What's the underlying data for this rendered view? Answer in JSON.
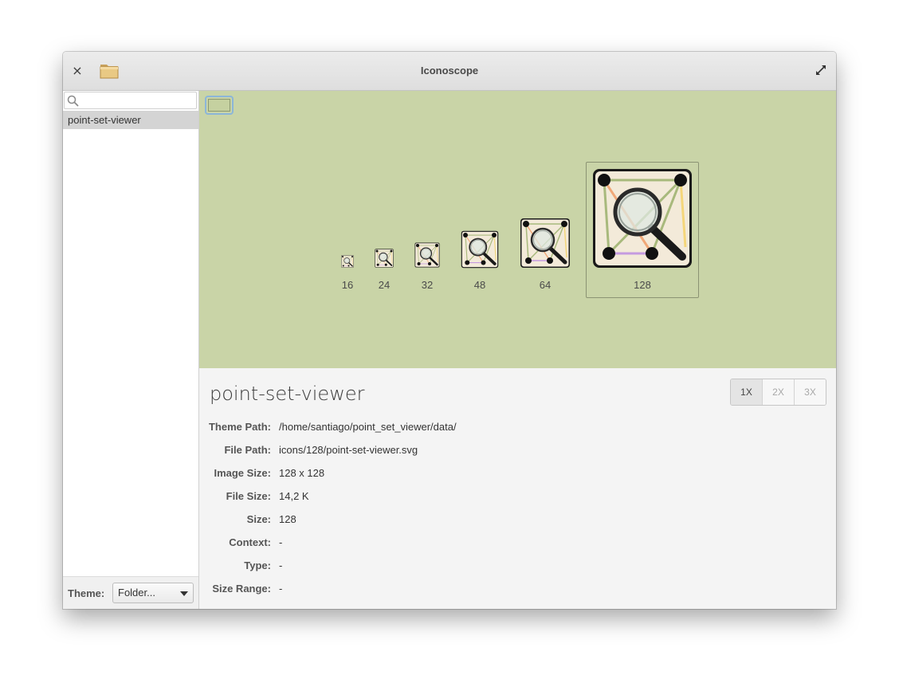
{
  "window": {
    "title": "Iconoscope",
    "close_glyph": "×"
  },
  "sidebar": {
    "search_placeholder": "",
    "search_value": "",
    "items": [
      {
        "label": "point-set-viewer",
        "selected": true
      }
    ],
    "theme_label": "Theme:",
    "theme_value": "Folder..."
  },
  "preview": {
    "background_color": "#c9d4a7",
    "sizes": [
      {
        "label": "16",
        "selected": false
      },
      {
        "label": "24",
        "selected": false
      },
      {
        "label": "32",
        "selected": false
      },
      {
        "label": "48",
        "selected": false
      },
      {
        "label": "64",
        "selected": false
      },
      {
        "label": "128",
        "selected": true
      }
    ]
  },
  "details": {
    "icon_name": "point-set-viewer",
    "scale_buttons": [
      "1X",
      "2X",
      "3X"
    ],
    "active_scale": "1X",
    "properties": [
      {
        "key": "Theme Path:",
        "value": "/home/santiago/point_set_viewer/data/"
      },
      {
        "key": "File Path:",
        "value": "icons/128/point-set-viewer.svg"
      },
      {
        "key": "Image Size:",
        "value": "128 x 128"
      },
      {
        "key": "File Size:",
        "value": "14,2 K"
      },
      {
        "key": "Size:",
        "value": "128"
      },
      {
        "key": "Context:",
        "value": "-"
      },
      {
        "key": "Type:",
        "value": "-"
      },
      {
        "key": "Size Range:",
        "value": "-"
      }
    ]
  },
  "icons": {
    "close": "close-icon",
    "folder": "folder-icon",
    "maximize": "maximize-icon",
    "search": "search-icon",
    "app_icon": "point-set-viewer-icon"
  }
}
